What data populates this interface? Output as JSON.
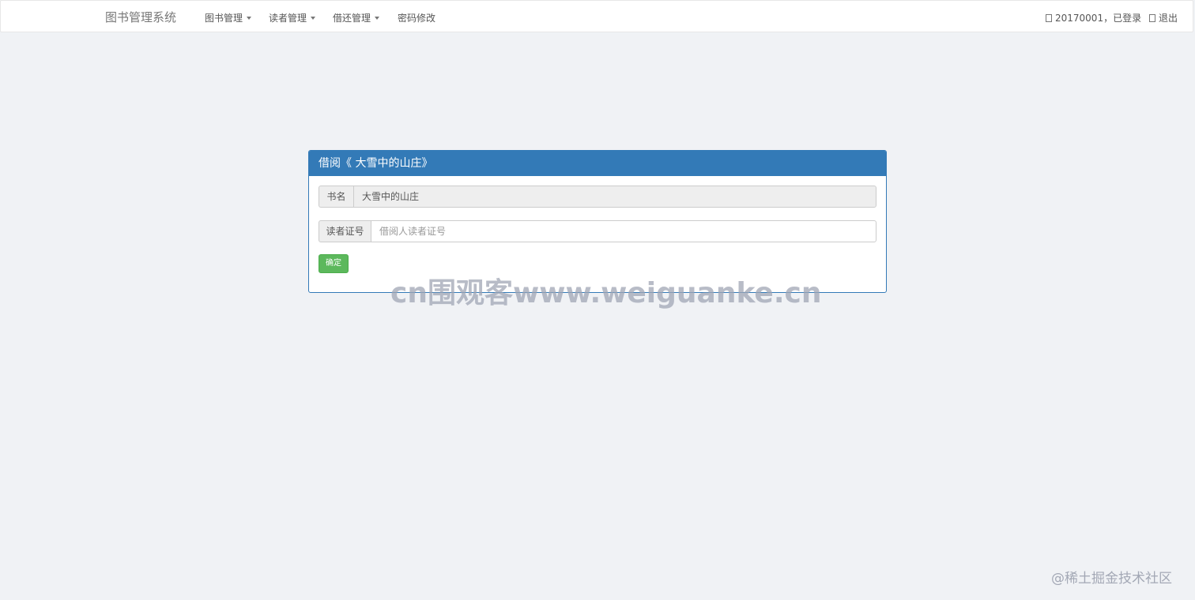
{
  "navbar": {
    "brand": "图书管理系统",
    "menus": [
      {
        "label": "图书管理",
        "dropdown": true
      },
      {
        "label": "读者管理",
        "dropdown": true
      },
      {
        "label": "借还管理",
        "dropdown": true
      },
      {
        "label": "密码修改",
        "dropdown": false
      }
    ],
    "user_status": "20170001，已登录",
    "user_icon": "user-icon",
    "logout": "退出",
    "logout_icon": "logout-icon"
  },
  "panel": {
    "title": "借阅《 大雪中的山庄》",
    "book_label": "书名",
    "book_value": "大雪中的山庄",
    "reader_label": "读者证号",
    "reader_placeholder": "借阅人读者证号",
    "confirm_button": "确定"
  },
  "watermarks": {
    "center": "cn围观客www.weiguanke.cn",
    "corner": "@稀土掘金技术社区"
  },
  "colors": {
    "primary": "#337ab7",
    "success": "#5cb85c",
    "background": "#f0f2f5"
  }
}
